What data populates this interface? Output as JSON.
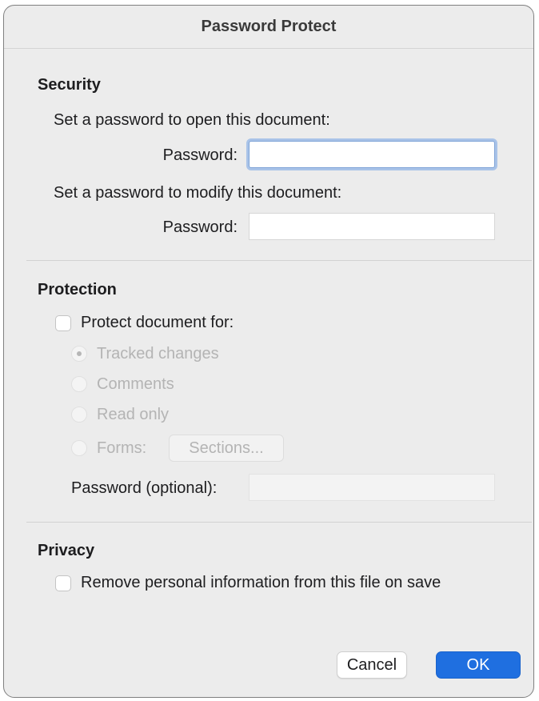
{
  "dialog": {
    "title": "Password Protect"
  },
  "security": {
    "heading": "Security",
    "open_prompt": "Set a password to open this document:",
    "open_password_label": "Password:",
    "open_password_value": "",
    "modify_prompt": "Set a password to modify this document:",
    "modify_password_label": "Password:",
    "modify_password_value": ""
  },
  "protection": {
    "heading": "Protection",
    "protect_checkbox_label": "Protect document for:",
    "protect_checked": false,
    "options": [
      {
        "label": "Tracked changes",
        "selected": true
      },
      {
        "label": "Comments",
        "selected": false
      },
      {
        "label": "Read only",
        "selected": false
      },
      {
        "label": "Forms:",
        "selected": false
      }
    ],
    "sections_button": "Sections...",
    "optional_password_label": "Password (optional):",
    "optional_password_value": ""
  },
  "privacy": {
    "heading": "Privacy",
    "remove_info_label": "Remove personal information from this file on save",
    "remove_info_checked": false
  },
  "buttons": {
    "cancel": "Cancel",
    "ok": "OK"
  },
  "colors": {
    "accent": "#1f6fe0",
    "focus_ring": "#a9c3e8",
    "panel_bg": "#ececec"
  }
}
